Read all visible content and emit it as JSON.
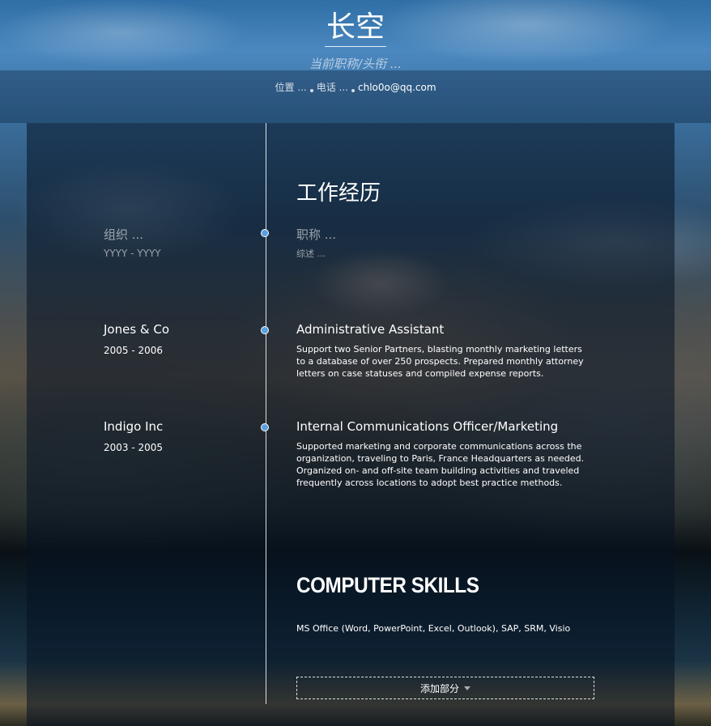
{
  "header": {
    "name": "长空",
    "subtitle": "当前职称/头衔 ...",
    "location": "位置 ...",
    "phone": "电话 ...",
    "email": "chlo0o@qq.com"
  },
  "experience": {
    "section_title": "工作经历",
    "entries": [
      {
        "org": "组织 ...",
        "years": "YYYY - YYYY",
        "title": "职称 ...",
        "description": "综述 ..."
      },
      {
        "org": "Jones & Co",
        "years": "2005 - 2006",
        "title": "Administrative Assistant",
        "description": "Support two Senior Partners, blasting monthly marketing letters to a database of over 250 prospects. Prepared monthly attorney letters on case statuses and compiled expense reports."
      },
      {
        "org": "Indigo Inc",
        "years": "2003 - 2005",
        "title": "Internal Communications Officer/Marketing",
        "description": "Supported marketing and corporate communications across the organization, traveling to Paris, France Headquarters as needed. Organized on- and off-site team building activities and traveled frequently across locations to adopt best practice methods."
      }
    ]
  },
  "skills": {
    "section_title": "COMPUTER SKILLS",
    "text": "MS Office (Word, PowerPoint, Excel, Outlook), SAP, SRM, Visio"
  },
  "actions": {
    "add_section_label": "添加部分"
  },
  "colors": {
    "timeline_dot": "#5aa0e0",
    "panel": "rgba(5,18,35,0.55)"
  }
}
